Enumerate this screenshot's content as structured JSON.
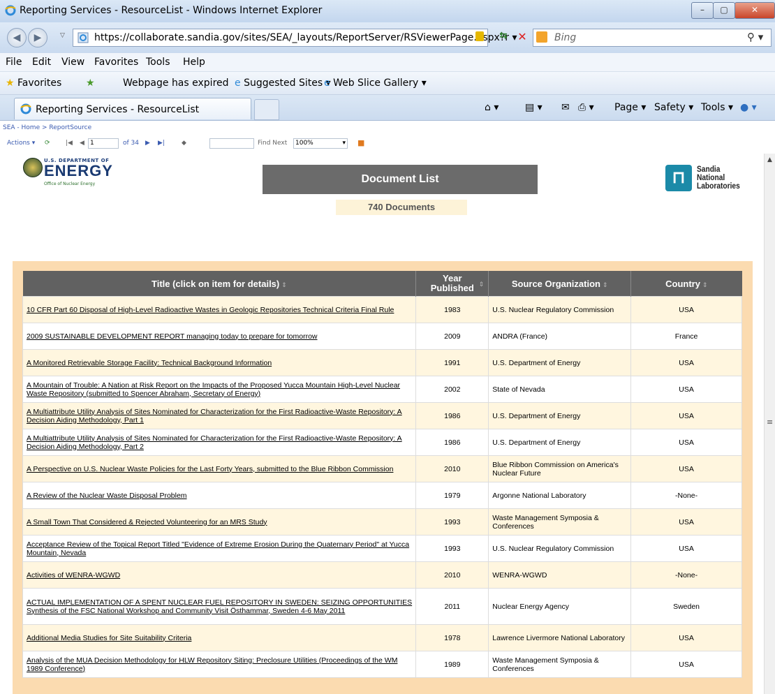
{
  "window": {
    "title": "Reporting Services - ResourceList - Windows Internet Explorer"
  },
  "address_bar": {
    "url_prefix": "https://collaborate.",
    "url_domain": "sandia.gov",
    "url_suffix": "/sites/SEA/_layouts/ReportServer/RSViewerPage.aspx?r",
    "search_placeholder": "Bing"
  },
  "menu": [
    "File",
    "Edit",
    "View",
    "Favorites",
    "Tools",
    "Help"
  ],
  "favorites_bar": {
    "favorites": "Favorites",
    "expired": "Webpage has expired",
    "suggested": "Suggested Sites ▾",
    "webslice": "Web Slice Gallery ▾"
  },
  "tab": {
    "label": "Reporting Services - ResourceList"
  },
  "command_bar": {
    "page": "Page ▾",
    "safety": "Safety ▾",
    "tools": "Tools ▾"
  },
  "breadcrumb": "SEA - Home > ReportSource",
  "viewer_toolbar": {
    "actions": "Actions ▾",
    "page_current": "1",
    "page_total": "of 34",
    "find_next": "Find Next",
    "zoom": "100%"
  },
  "report": {
    "doe_small": "U.S. DEPARTMENT OF",
    "doe_big": "ENERGY",
    "doe_sub": "Office of Nuclear Energy",
    "banner": "Document List",
    "count": "740 Documents",
    "sandia": [
      "Sandia",
      "National",
      "Laboratories"
    ],
    "columns": {
      "title": "Title (click on item for details)",
      "year_line1": "Year",
      "year_line2": "Published",
      "source": "Source Organization",
      "country": "Country"
    },
    "rows": [
      {
        "title": "10 CFR Part 60 Disposal of High-Level Radioactive Wastes in Geologic Repositories Technical Criteria Final Rule",
        "year": "1983",
        "source": "U.S. Nuclear Regulatory Commission",
        "country": "USA"
      },
      {
        "title": "2009 SUSTAINABLE DEVELOPMENT REPORT managing today to prepare for tomorrow",
        "year": "2009",
        "source": "ANDRA (France)",
        "country": "France"
      },
      {
        "title": "A Monitored Retrievable Storage Facility: Technical Background Information",
        "year": "1991",
        "source": "U.S. Department of Energy",
        "country": "USA"
      },
      {
        "title": "A Mountain of Trouble: A Nation at Risk Report on the Impacts of the Proposed Yucca Mountain High-Level Nuclear Waste Repository (submitted to Spencer Abraham, Secretary of Energy)",
        "year": "2002",
        "source": "State of Nevada",
        "country": "USA"
      },
      {
        "title": "A Multiattribute Utility Analysis of Sites Nominated for Characterization for the First Radioactive-Waste Repository: A Decision Aiding Methodology, Part 1",
        "year": "1986",
        "source": "U.S. Department of Energy",
        "country": "USA"
      },
      {
        "title": "A Multiattribute Utility Analysis of Sites Nominated for Characterization for the First Radioactive-Waste Repository: A Decision Aiding Methodology, Part 2",
        "year": "1986",
        "source": "U.S. Department of Energy",
        "country": "USA"
      },
      {
        "title": "A Perspective on U.S. Nuclear Waste Policies for the Last Forty Years, submitted to the Blue Ribbon Commission",
        "year": "2010",
        "source": "Blue Ribbon Commission on America's Nuclear Future",
        "country": "USA"
      },
      {
        "title": "A Review of the Nuclear Waste Disposal Problem",
        "year": "1979",
        "source": "Argonne National Laboratory",
        "country": "-None-"
      },
      {
        "title": "A Small Town That Considered & Rejected Volunteering for an MRS Study",
        "year": "1993",
        "source": "Waste Management Symposia & Conferences",
        "country": "USA"
      },
      {
        "title": "Acceptance Review of the Topical Report Titled \"Evidence of Extreme Erosion During the Quaternary Period\" at Yucca Mountain, Nevada",
        "year": "1993",
        "source": "U.S. Nuclear Regulatory Commission",
        "country": "USA"
      },
      {
        "title": "Activities of WENRA-WGWD",
        "year": "2010",
        "source": "WENRA-WGWD",
        "country": "-None-"
      },
      {
        "title": "ACTUAL IMPLEMENTATION OF A SPENT NUCLEAR FUEL REPOSITORY IN SWEDEN: SEIZING OPPORTUNITIES Synthesis of the FSC National Workshop and Community Visit Östhammar, Sweden 4-6 May 2011",
        "year": "2011",
        "source": "Nuclear Energy Agency",
        "country": "Sweden"
      },
      {
        "title": "Additional Media Studies for Site Suitability Criteria",
        "year": "1978",
        "source": "Lawrence Livermore National Laboratory",
        "country": "USA"
      },
      {
        "title": "Analysis of the MUA Decision Methodology for HLW Repository Siting: Preclosure Utilities (Proceedings of the WM 1989 Conference)",
        "year": "1989",
        "source": "Waste Management Symposia & Conferences",
        "country": "USA"
      }
    ]
  }
}
